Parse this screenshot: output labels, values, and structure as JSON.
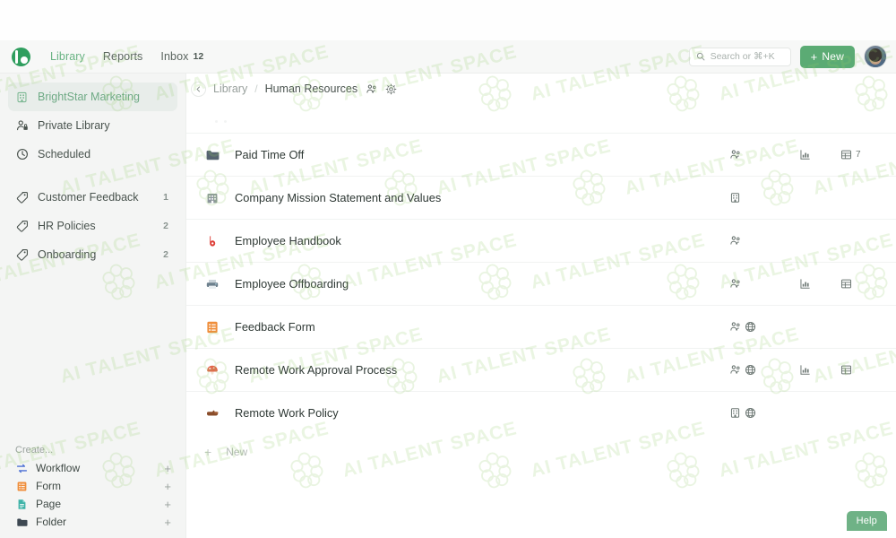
{
  "app": {
    "logo_icon": "brand-b-logo-icon",
    "nav": [
      {
        "label": "Library",
        "active": true
      },
      {
        "label": "Reports",
        "active": false
      },
      {
        "label": "Inbox",
        "active": false,
        "badge": "12"
      }
    ],
    "search": {
      "placeholder": "Search or ⌘+K",
      "value": "",
      "icon": "search-icon"
    },
    "new_button": {
      "label": "New",
      "plus": "+",
      "color": "#5bab74"
    },
    "avatar": "user-avatar"
  },
  "sidebar": {
    "items": [
      {
        "label": "BrightStar Marketing",
        "icon": "building-icon",
        "selected": true,
        "count": ""
      },
      {
        "label": "Private Library",
        "icon": "private-person-icon",
        "selected": false,
        "count": ""
      },
      {
        "label": "Scheduled",
        "icon": "clock-icon",
        "selected": false,
        "count": ""
      }
    ],
    "tags": [
      {
        "label": "Customer Feedback",
        "icon": "tag-icon",
        "count": "1"
      },
      {
        "label": "HR Policies",
        "icon": "tag-icon",
        "count": "2"
      },
      {
        "label": "Onboarding",
        "icon": "tag-icon",
        "count": "2"
      }
    ],
    "create": {
      "title": "Create...",
      "items": [
        {
          "label": "Workflow",
          "icon": "workflow-icon",
          "color": "#4b6fd4",
          "plus": "+"
        },
        {
          "label": "Form",
          "icon": "form-icon",
          "color": "#ef8e3b",
          "plus": "+"
        },
        {
          "label": "Page",
          "icon": "page-icon",
          "color": "#3fb3a8",
          "plus": "+"
        },
        {
          "label": "Folder",
          "icon": "folder-icon",
          "color": "#3d4852",
          "plus": "+"
        }
      ]
    }
  },
  "main": {
    "collapse_icon": "chevron-left-icon",
    "breadcrumb": {
      "root": "Library",
      "separator": "/",
      "current": "Human Resources",
      "share_icon": "people-share-icon",
      "settings_icon": "gear-icon"
    },
    "rows": [
      {
        "title": "Paid Time Off",
        "icon": "folder-icon",
        "shared": true,
        "shared_icon": "people-share-icon",
        "published": false,
        "published_icon": "globe-icon",
        "chart": true,
        "chart_icon": "bar-chart-icon",
        "table": true,
        "table_icon": "table-icon",
        "table_count": "7"
      },
      {
        "title": "Company Mission Statement and Values",
        "icon": "building-icon",
        "shared": false,
        "shared_icon": "building-small-icon",
        "org": true,
        "published": false,
        "published_icon": "globe-icon",
        "chart": false,
        "chart_icon": "bar-chart-icon",
        "table": false,
        "table_icon": "table-icon",
        "table_count": ""
      },
      {
        "title": "Employee Handbook",
        "icon": "brand-b-red-icon",
        "shared": true,
        "shared_icon": "people-share-icon",
        "published": false,
        "published_icon": "globe-icon",
        "chart": false,
        "chart_icon": "bar-chart-icon",
        "table": false,
        "table_icon": "table-icon",
        "table_count": ""
      },
      {
        "title": "Employee Offboarding",
        "icon": "printer-icon",
        "shared": true,
        "shared_icon": "people-share-icon",
        "published": false,
        "published_icon": "globe-icon",
        "chart": true,
        "chart_icon": "bar-chart-icon",
        "table": true,
        "table_icon": "table-icon",
        "table_count": ""
      },
      {
        "title": "Feedback Form",
        "icon": "form-icon",
        "shared": true,
        "shared_icon": "people-share-icon",
        "published": true,
        "published_icon": "globe-icon",
        "chart": false,
        "chart_icon": "bar-chart-icon",
        "table": false,
        "table_icon": "table-icon",
        "table_count": ""
      },
      {
        "title": "Remote Work Approval Process",
        "icon": "mushroom-icon",
        "shared": true,
        "shared_icon": "people-share-icon",
        "published": true,
        "published_icon": "globe-icon",
        "chart": true,
        "chart_icon": "bar-chart-icon",
        "table": true,
        "table_icon": "table-icon",
        "table_count": ""
      },
      {
        "title": "Remote Work Policy",
        "icon": "pointing-hand-icon",
        "shared": false,
        "org": true,
        "shared_icon": "building-small-icon",
        "published": true,
        "published_icon": "globe-icon",
        "chart": false,
        "chart_icon": "bar-chart-icon",
        "table": false,
        "table_icon": "table-icon",
        "table_count": ""
      }
    ],
    "new_row": {
      "plus": "+",
      "label": "New"
    }
  },
  "help": {
    "label": "Help",
    "color": "#6fb286"
  },
  "watermark": {
    "text": "AI TALENT SPACE"
  }
}
